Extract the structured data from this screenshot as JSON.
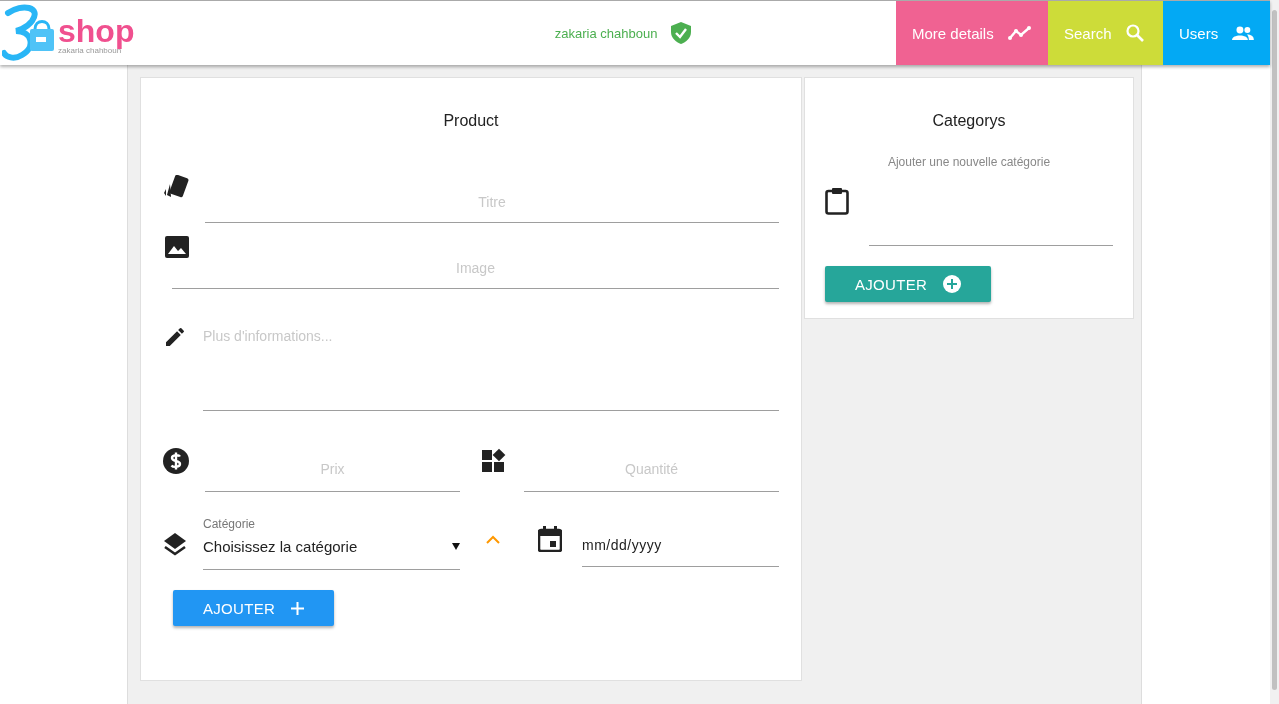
{
  "header": {
    "logo": {
      "word": "shop",
      "subtitle": "zakaria chahboun"
    },
    "user": "zakaria chahboun",
    "nav": [
      {
        "label": "More details",
        "color": "#f06292"
      },
      {
        "label": "Search",
        "color": "#cddc39"
      },
      {
        "label": "Users",
        "color": "#03a9f4"
      }
    ]
  },
  "product": {
    "title": "Product",
    "titre": {
      "placeholder": "Titre"
    },
    "image": {
      "placeholder": "Image"
    },
    "info": {
      "placeholder": "Plus d'informations..."
    },
    "prix": {
      "placeholder": "Prix"
    },
    "quantite": {
      "placeholder": "Quantité"
    },
    "categorie": {
      "label": "Catégorie",
      "value": "Choisissez la catégorie"
    },
    "date": {
      "value": "mm/dd/yyyy"
    },
    "button": "AJOUTER"
  },
  "categorys": {
    "title": "Categorys",
    "hint": "Ajouter une nouvelle catégorie",
    "button": "AJOUTER"
  }
}
